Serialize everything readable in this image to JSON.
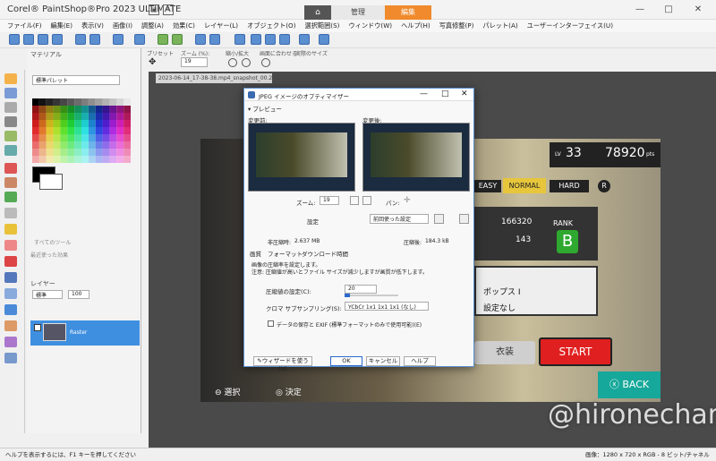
{
  "app": {
    "title": "Corel® PaintShop®Pro 2023 ULTIMATE",
    "tabs": {
      "manage": "管理",
      "edit": "編集"
    }
  },
  "menu": [
    "ファイル(F)",
    "編集(E)",
    "表示(V)",
    "画像(I)",
    "調整(A)",
    "効果(C)",
    "レイヤー(L)",
    "オブジェクト(O)",
    "選択範囲(S)",
    "ウィンドウ(W)",
    "ヘルプ(H)",
    "写真修整(P)",
    "パレット(A)",
    "ユーザーインターフェイス(U)"
  ],
  "optbar": {
    "tool_label": "プリセット",
    "zoom_label": "ズーム (%):",
    "zoom_value": "19",
    "zoom_inout_label": "縮小/拡大",
    "fit_label": "画面に合わせる",
    "actual_label": "実際のサイズ"
  },
  "materials": {
    "title": "マテリアル",
    "palette_select": "標準パレット",
    "all_tools": "すべてのツール",
    "recent_label": "最近使った効果"
  },
  "layers": {
    "title": "レイヤー",
    "blend_mode": "標準",
    "opacity": "100",
    "layer_name": "Raster"
  },
  "doc_tab": "2023-06-14_17-38-38.mp4_snapshot_00.22_...",
  "game": {
    "level": "LV",
    "level_value": "33",
    "points": "78920",
    "points_unit": "pts",
    "diff_easy": "EASY",
    "diff_normal": "NORMAL",
    "diff_hard": "HARD",
    "diff_r": "R",
    "score": "166320",
    "count": "143",
    "rank_label": "RANK",
    "rank": "B",
    "list1": "ポップス I",
    "list2": "設定なし",
    "costume": "衣装",
    "start": "START",
    "back": "BACK",
    "select": "選択",
    "decide": "決定"
  },
  "watermark": "@hironechan",
  "status": {
    "help": "ヘルプを表示するには、F1 キーを押してください",
    "image_info": "画像：1280 x 720 x RGB - 8 ビット/チャネル"
  },
  "dialog": {
    "title": "JPEG イメージのオプティマイザー",
    "preview_label": "プレビュー",
    "before_label": "変更前:",
    "after_label": "変更後:",
    "zoom_label": "ズーム:",
    "zoom_value": "19",
    "pan_label": "パン:",
    "settings_label": "設定",
    "settings_value": "前回使った設定",
    "uncompressed_label": "非圧縮時:",
    "uncompressed_value": "2.637 MB",
    "compressed_label": "圧縮後:",
    "compressed_value": "184.3 kB",
    "tab_quality": "画質",
    "tab_format": "フォーマット",
    "tab_download": "ダウンロード時間",
    "desc1": "画像の圧縮率を設定します。",
    "desc2": "注意: 圧縮値が高いとファイル サイズが減少しますが画質が低下します。",
    "compress_label": "圧縮値の設定(C):",
    "compress_value": "20",
    "chroma_label": "クロマ サブサンプリング(S):",
    "chroma_value": "YCbCr 1x1 1x1 1x1 (なし)",
    "exif_label": "データの保存と EXIF (標準フォーマットのみで使用可能)(E)",
    "wizard_button": "ウィザードを使う(U)",
    "ok_button": "OK",
    "cancel_button": "キャンセル",
    "help_button": "ヘルプ"
  }
}
